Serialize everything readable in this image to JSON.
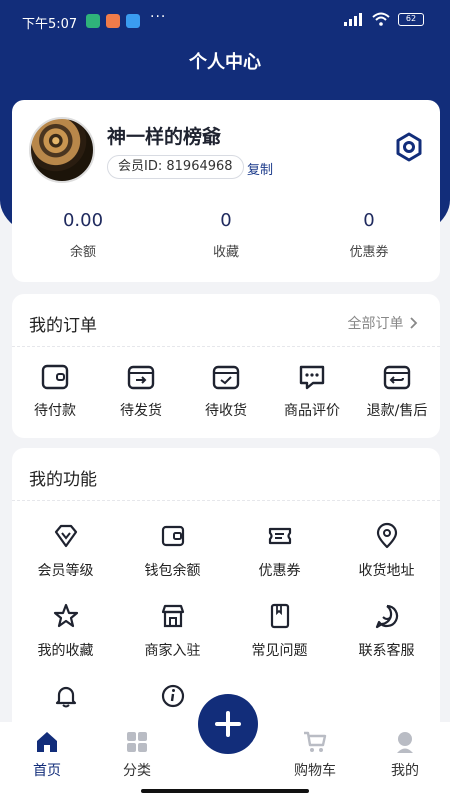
{
  "status_bar": {
    "time": "下午5:07",
    "dots": "···",
    "battery": "62"
  },
  "header": {
    "title": "个人中心"
  },
  "profile": {
    "username": "神一样的榜爺",
    "member_id_label": "会员ID:",
    "member_id": "81964968",
    "copy_label": "复制",
    "stats": [
      {
        "value": "0.00",
        "label": "余额"
      },
      {
        "value": "0",
        "label": "收藏"
      },
      {
        "value": "0",
        "label": "优惠券"
      }
    ]
  },
  "orders": {
    "title": "我的订单",
    "all_label": "全部订单",
    "items": [
      {
        "label": "待付款",
        "icon": "wallet-icon"
      },
      {
        "label": "待发货",
        "icon": "box-arrow-icon"
      },
      {
        "label": "待收货",
        "icon": "box-check-icon"
      },
      {
        "label": "商品评价",
        "icon": "chat-bubble-icon"
      },
      {
        "label": "退款/售后",
        "icon": "box-return-icon"
      }
    ]
  },
  "functions": {
    "title": "我的功能",
    "items": [
      {
        "label": "会员等级",
        "icon": "diamond-icon"
      },
      {
        "label": "钱包余额",
        "icon": "wallet-icon"
      },
      {
        "label": "优惠券",
        "icon": "ticket-icon"
      },
      {
        "label": "收货地址",
        "icon": "location-pin-icon"
      },
      {
        "label": "我的收藏",
        "icon": "star-icon"
      },
      {
        "label": "商家入驻",
        "icon": "storefront-icon"
      },
      {
        "label": "常见问题",
        "icon": "book-icon"
      },
      {
        "label": "联系客服",
        "icon": "chat-round-icon"
      },
      {
        "label": "",
        "icon": "bell-icon"
      },
      {
        "label": "",
        "icon": "info-icon"
      }
    ]
  },
  "tabbar": {
    "items": [
      {
        "label": "首页",
        "icon": "home-icon",
        "active": true
      },
      {
        "label": "分类",
        "icon": "grid-icon",
        "active": false
      },
      {
        "label": "购物车",
        "icon": "cart-icon",
        "active": false
      },
      {
        "label": "我的",
        "icon": "user-icon",
        "active": false
      }
    ],
    "fab_icon": "plus-icon"
  },
  "colors": {
    "primary": "#122d7a",
    "background": "#f2f3f6",
    "card": "#ffffff",
    "text": "#1f2330"
  }
}
